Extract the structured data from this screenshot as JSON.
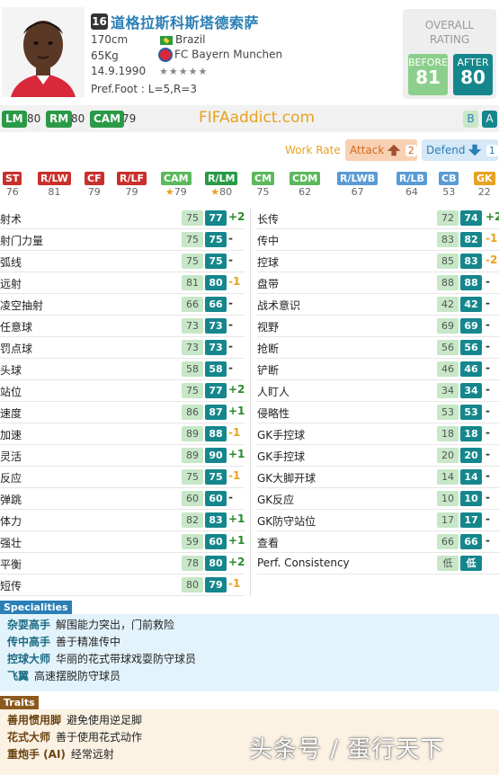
{
  "player": {
    "number": "16",
    "name": "道格拉斯科斯塔德索萨",
    "height": "170cm",
    "weight": "65Kg",
    "birth": "14.9.1990",
    "nation": "Brazil",
    "club": "FC Bayern Munchen",
    "pref_foot": "Pref.Foot : L=5,R=3",
    "stars": "★★★★★"
  },
  "rating": {
    "title_line1": "OVERALL",
    "title_line2": "RATING",
    "before_label": "BEFORE",
    "before_value": "81",
    "after_label": "AFTER",
    "after_value": "80"
  },
  "positions_top": [
    {
      "tag": "LM",
      "val": "80"
    },
    {
      "tag": "RM",
      "val": "80"
    },
    {
      "tag": "CAM",
      "val": "79"
    }
  ],
  "site": "FIFAaddict.com",
  "gk_buttons": [
    "B",
    "A"
  ],
  "work_rate": {
    "label": "Work Rate :",
    "attack_label": "Attack",
    "attack_value": "2",
    "defend_label": "Defend",
    "defend_value": "1"
  },
  "position_ratings": [
    {
      "tag": "ST",
      "val": "76",
      "color": "#c9302c"
    },
    {
      "tag": "R/LW",
      "val": "81",
      "color": "#c9302c"
    },
    {
      "tag": "CF",
      "val": "79",
      "color": "#c9302c"
    },
    {
      "tag": "R/LF",
      "val": "79",
      "color": "#c9302c"
    },
    {
      "tag": "CAM",
      "val": "79",
      "color": "#5cb85c",
      "star": "★"
    },
    {
      "tag": "R/LM",
      "val": "80",
      "color": "#2a9a47",
      "star": "★"
    },
    {
      "tag": "CM",
      "val": "75",
      "color": "#5cb85c"
    },
    {
      "tag": "CDM",
      "val": "62",
      "color": "#5cb85c"
    },
    {
      "tag": "R/LWB",
      "val": "67",
      "color": "#5b9bd5"
    },
    {
      "tag": "R/LB",
      "val": "64",
      "color": "#5b9bd5"
    },
    {
      "tag": "CB",
      "val": "53",
      "color": "#5b9bd5"
    },
    {
      "tag": "GK",
      "val": "22",
      "color": "#e7a21f"
    }
  ],
  "stats_left": [
    {
      "name": "射术",
      "before": "75",
      "after": "77",
      "delta": "+2"
    },
    {
      "name": "射门力量",
      "before": "75",
      "after": "75",
      "delta": "-"
    },
    {
      "name": "弧线",
      "before": "75",
      "after": "75",
      "delta": "-"
    },
    {
      "name": "远射",
      "before": "81",
      "after": "80",
      "delta": "-1"
    },
    {
      "name": "凌空抽射",
      "before": "66",
      "after": "66",
      "delta": "-"
    },
    {
      "name": "任意球",
      "before": "73",
      "after": "73",
      "delta": "-"
    },
    {
      "name": "罚点球",
      "before": "73",
      "after": "73",
      "delta": "-"
    },
    {
      "name": "头球",
      "before": "58",
      "after": "58",
      "delta": "-"
    },
    {
      "name": "站位",
      "before": "75",
      "after": "77",
      "delta": "+2"
    },
    {
      "name": "速度",
      "before": "86",
      "after": "87",
      "delta": "+1"
    },
    {
      "name": "加速",
      "before": "89",
      "after": "88",
      "delta": "-1"
    },
    {
      "name": "灵活",
      "before": "89",
      "after": "90",
      "delta": "+1"
    },
    {
      "name": "反应",
      "before": "75",
      "after": "75",
      "delta": "-1"
    },
    {
      "name": "弹跳",
      "before": "60",
      "after": "60",
      "delta": "-"
    },
    {
      "name": "体力",
      "before": "82",
      "after": "83",
      "delta": "+1"
    },
    {
      "name": "强壮",
      "before": "59",
      "after": "60",
      "delta": "+1"
    },
    {
      "name": "平衡",
      "before": "78",
      "after": "80",
      "delta": "+2"
    },
    {
      "name": "短传",
      "before": "80",
      "after": "79",
      "delta": "-1"
    }
  ],
  "stats_right": [
    {
      "name": "长传",
      "before": "72",
      "after": "74",
      "delta": "+2"
    },
    {
      "name": "传中",
      "before": "83",
      "after": "82",
      "delta": "-1"
    },
    {
      "name": "控球",
      "before": "85",
      "after": "83",
      "delta": "-2"
    },
    {
      "name": "盘带",
      "before": "88",
      "after": "88",
      "delta": "-"
    },
    {
      "name": "战术意识",
      "before": "42",
      "after": "42",
      "delta": "-"
    },
    {
      "name": "视野",
      "before": "69",
      "after": "69",
      "delta": "-"
    },
    {
      "name": "抢断",
      "before": "56",
      "after": "56",
      "delta": "-"
    },
    {
      "name": "铲断",
      "before": "46",
      "after": "46",
      "delta": "-"
    },
    {
      "name": "人盯人",
      "before": "34",
      "after": "34",
      "delta": "-"
    },
    {
      "name": "侵略性",
      "before": "53",
      "after": "53",
      "delta": "-"
    },
    {
      "name": "GK手控球",
      "before": "18",
      "after": "18",
      "delta": "-"
    },
    {
      "name": "GK手控球",
      "before": "20",
      "after": "20",
      "delta": "-"
    },
    {
      "name": "GK大脚开球",
      "before": "14",
      "after": "14",
      "delta": "-"
    },
    {
      "name": "GK反应",
      "before": "10",
      "after": "10",
      "delta": "-"
    },
    {
      "name": "GK防守站位",
      "before": "17",
      "after": "17",
      "delta": "-"
    },
    {
      "name": "查看",
      "before": "66",
      "after": "66",
      "delta": "-"
    },
    {
      "name": "Perf. Consistency",
      "before": "低",
      "after": "低",
      "delta": ""
    }
  ],
  "specialities": {
    "title": "Specialities",
    "items": [
      {
        "name": "杂耍高手",
        "desc": "解围能力突出，门前救险"
      },
      {
        "name": "传中高手",
        "desc": "善于精准传中"
      },
      {
        "name": "控球大师",
        "desc": "华丽的花式带球戏耍防守球员"
      },
      {
        "name": "飞翼",
        "desc": "高速摆脱防守球员"
      }
    ]
  },
  "traits": {
    "title": "Traits",
    "items": [
      {
        "name": "善用惯用脚",
        "desc": "避免使用逆足脚"
      },
      {
        "name": "花式大师",
        "desc": "善于使用花式动作"
      },
      {
        "name": "重炮手 (AI)",
        "desc": "经常远射"
      }
    ]
  },
  "watermark": "头条号 / 蛋行天下",
  "colors": {
    "after": "#15878c",
    "before": "#c7e7c7",
    "plus": "#2a8a2a",
    "minus": "#e7a21f",
    "accent": "#2a7fb6"
  }
}
